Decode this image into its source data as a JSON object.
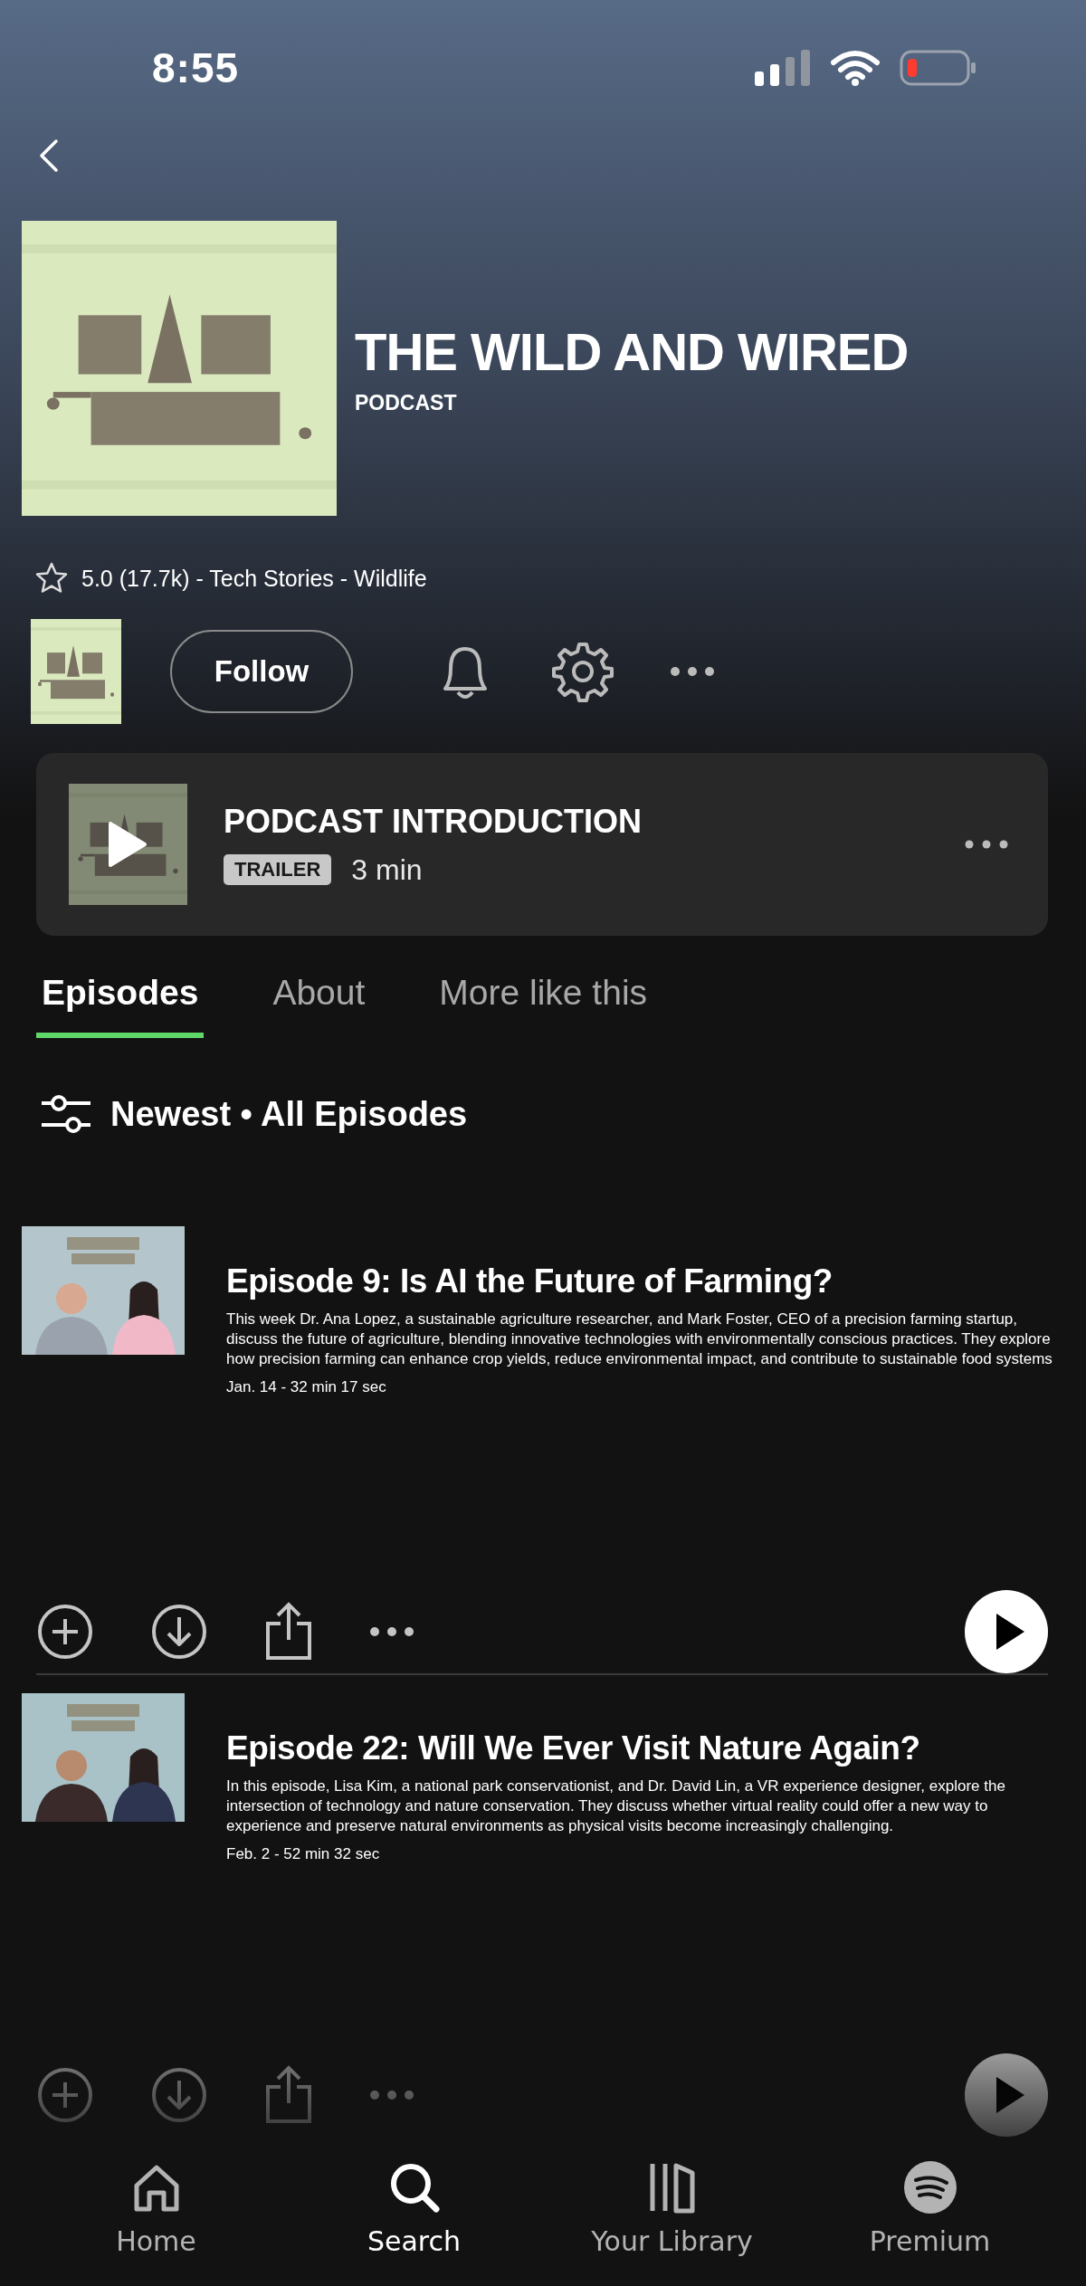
{
  "status_bar": {
    "time": "8:55"
  },
  "podcast": {
    "title": "THE WILD AND WIRED",
    "type_label": "PODCAST",
    "rating_line": "5.0 (17.7k) - Tech Stories - Wildlife",
    "follow_label": "Follow"
  },
  "trailer": {
    "title": "PODCAST INTRODUCTION",
    "badge": "TRAILER",
    "duration": "3 min"
  },
  "tabs": [
    {
      "label": "Episodes",
      "selected": true
    },
    {
      "label": "About",
      "selected": false
    },
    {
      "label": "More like this",
      "selected": false
    }
  ],
  "filter": {
    "label": "Newest • All Episodes"
  },
  "episodes": [
    {
      "title": "Episode 9: Is AI the Future of Farming?",
      "description": "This week Dr. Ana Lopez, a sustainable agriculture researcher, and Mark Foster, CEO of a precision farming startup, discuss the future of agriculture, blending innovative technologies with environmentally conscious practices. They explore how precision farming can enhance crop yields, reduce environmental impact, and contribute to sustainable food systems",
      "meta": "Jan. 14 - 32 min 17 sec"
    },
    {
      "title": "Episode 22: Will We Ever Visit Nature Again?",
      "description": "In this episode, Lisa Kim, a national park conservationist, and Dr. David Lin, a VR experience designer, explore the intersection of technology and nature conservation. They discuss whether virtual reality could offer a new way to experience and preserve natural environments as physical visits become increasingly challenging.",
      "meta": "Feb. 2 - 52 min 32 sec"
    }
  ],
  "nav": [
    {
      "kind": "home",
      "label": "Home",
      "selected": false
    },
    {
      "kind": "search",
      "label": "Search",
      "selected": true
    },
    {
      "kind": "library",
      "label": "Your Library",
      "selected": false
    },
    {
      "kind": "premium",
      "label": "Premium",
      "selected": false
    }
  ]
}
